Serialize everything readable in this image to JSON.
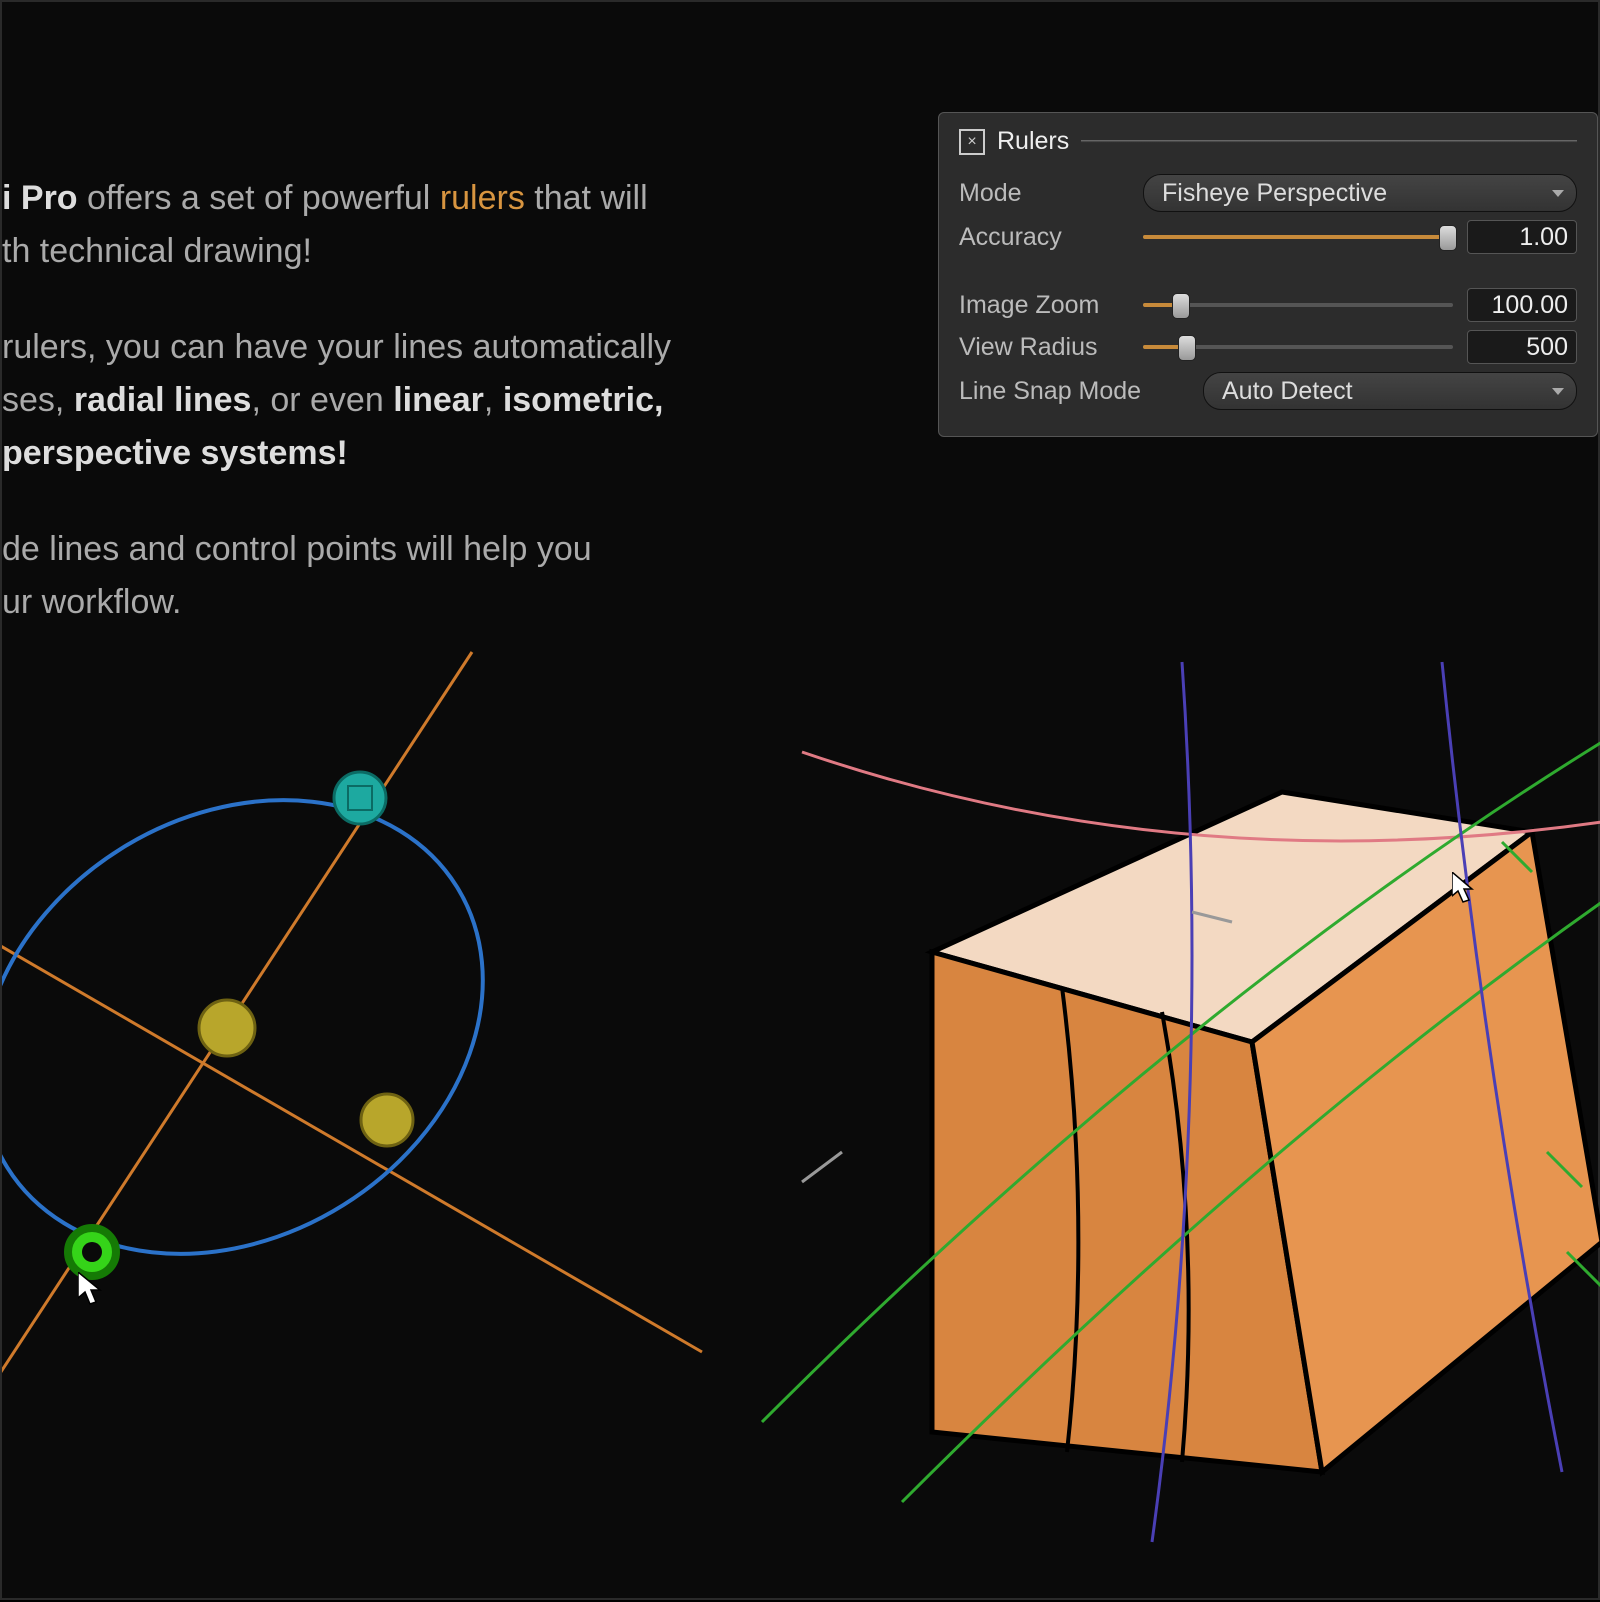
{
  "desc": {
    "p1_pre": "i Pro",
    "p1_mid": " offers a set of powerful ",
    "p1_hl": "rulers",
    "p1_post": " that will",
    "p1_line2": "th technical drawing!",
    "p2_a": " rulers, you can have your lines automatically",
    "p2_b_pre": "ses, ",
    "p2_b_hl1": "radial lines",
    "p2_b_mid": ", or even ",
    "p2_b_hl2": "linear",
    "p2_b_sep": ", ",
    "p2_b_hl3": "isometric,",
    "p2_c": " perspective systems!",
    "p3_a": "de lines and control points will help you",
    "p3_b": "ur workflow."
  },
  "panel": {
    "title": "Rulers",
    "mode_label": "Mode",
    "mode_value": "Fisheye Perspective",
    "accuracy_label": "Accuracy",
    "accuracy_value": "1.00",
    "accuracy_fill_pct": 98,
    "zoom_label": "Image Zoom",
    "zoom_value": "100.00",
    "zoom_fill_pct": 12,
    "radius_label": "View Radius",
    "radius_value": "500",
    "radius_fill_pct": 14,
    "snap_label": "Line Snap Mode",
    "snap_value": "Auto Detect"
  },
  "icons": {
    "checkbox": "×"
  }
}
